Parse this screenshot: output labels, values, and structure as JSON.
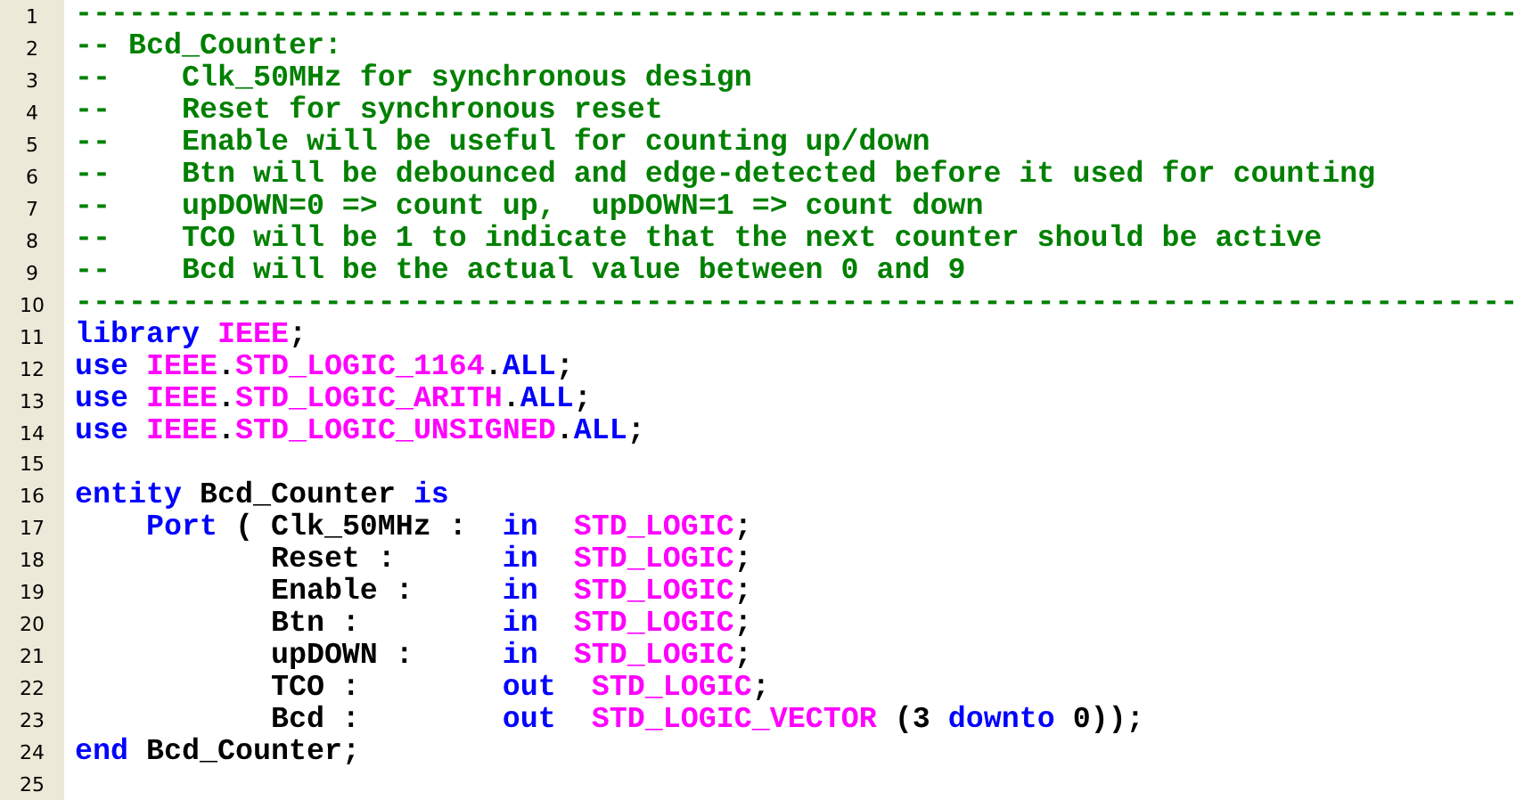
{
  "editor": {
    "lines": [
      {
        "number": "1",
        "tokens": [
          {
            "kind": "comment",
            "text": "---------------------------------------------------------------------------------"
          }
        ]
      },
      {
        "number": "2",
        "tokens": [
          {
            "kind": "comment",
            "text": "-- Bcd_Counter:"
          }
        ]
      },
      {
        "number": "3",
        "tokens": [
          {
            "kind": "comment",
            "text": "--    Clk_50MHz for synchronous design"
          }
        ]
      },
      {
        "number": "4",
        "tokens": [
          {
            "kind": "comment",
            "text": "--    Reset for synchronous reset"
          }
        ]
      },
      {
        "number": "5",
        "tokens": [
          {
            "kind": "comment",
            "text": "--    Enable will be useful for counting up/down"
          }
        ]
      },
      {
        "number": "6",
        "tokens": [
          {
            "kind": "comment",
            "text": "--    Btn will be debounced and edge-detected before it used for counting"
          }
        ]
      },
      {
        "number": "7",
        "tokens": [
          {
            "kind": "comment",
            "text": "--    upDOWN=0 => count up,  upDOWN=1 => count down"
          }
        ]
      },
      {
        "number": "8",
        "tokens": [
          {
            "kind": "comment",
            "text": "--    TCO will be 1 to indicate that the next counter should be active"
          }
        ]
      },
      {
        "number": "9",
        "tokens": [
          {
            "kind": "comment",
            "text": "--    Bcd will be the actual value between 0 and 9"
          }
        ]
      },
      {
        "number": "10",
        "tokens": [
          {
            "kind": "comment",
            "text": "---------------------------------------------------------------------------------"
          }
        ]
      },
      {
        "number": "11",
        "tokens": [
          {
            "kind": "keyword",
            "text": "library"
          },
          {
            "kind": "type",
            "text": " IEEE"
          },
          {
            "kind": "plain",
            "text": ";"
          }
        ]
      },
      {
        "number": "12",
        "tokens": [
          {
            "kind": "keyword",
            "text": "use"
          },
          {
            "kind": "type",
            "text": " IEEE"
          },
          {
            "kind": "plain",
            "text": "."
          },
          {
            "kind": "type",
            "text": "STD_LOGIC_1164"
          },
          {
            "kind": "plain",
            "text": "."
          },
          {
            "kind": "keyword",
            "text": "ALL"
          },
          {
            "kind": "plain",
            "text": ";"
          }
        ]
      },
      {
        "number": "13",
        "tokens": [
          {
            "kind": "keyword",
            "text": "use"
          },
          {
            "kind": "type",
            "text": " IEEE"
          },
          {
            "kind": "plain",
            "text": "."
          },
          {
            "kind": "type",
            "text": "STD_LOGIC_ARITH"
          },
          {
            "kind": "plain",
            "text": "."
          },
          {
            "kind": "keyword",
            "text": "ALL"
          },
          {
            "kind": "plain",
            "text": ";"
          }
        ]
      },
      {
        "number": "14",
        "tokens": [
          {
            "kind": "keyword",
            "text": "use"
          },
          {
            "kind": "type",
            "text": " IEEE"
          },
          {
            "kind": "plain",
            "text": "."
          },
          {
            "kind": "type",
            "text": "STD_LOGIC_UNSIGNED"
          },
          {
            "kind": "plain",
            "text": "."
          },
          {
            "kind": "keyword",
            "text": "ALL"
          },
          {
            "kind": "plain",
            "text": ";"
          }
        ]
      },
      {
        "number": "15"
      },
      {
        "number": "16",
        "tokens": [
          {
            "kind": "keyword",
            "text": "entity"
          },
          {
            "kind": "plain",
            "text": " Bcd_Counter"
          },
          {
            "kind": "keyword",
            "text": " is"
          }
        ]
      },
      {
        "number": "17",
        "tokens": [
          {
            "kind": "keyword",
            "text": "    Port"
          },
          {
            "kind": "plain",
            "text": " ( Clk_50MHz :"
          },
          {
            "kind": "keyword",
            "text": "  in"
          },
          {
            "kind": "type",
            "text": "  STD_LOGIC"
          },
          {
            "kind": "plain",
            "text": ";"
          }
        ]
      },
      {
        "number": "18",
        "tokens": [
          {
            "kind": "plain",
            "text": "           Reset :"
          },
          {
            "kind": "keyword",
            "text": "      in"
          },
          {
            "kind": "type",
            "text": "  STD_LOGIC"
          },
          {
            "kind": "plain",
            "text": ";"
          }
        ]
      },
      {
        "number": "19",
        "tokens": [
          {
            "kind": "plain",
            "text": "           Enable :"
          },
          {
            "kind": "keyword",
            "text": "     in"
          },
          {
            "kind": "type",
            "text": "  STD_LOGIC"
          },
          {
            "kind": "plain",
            "text": ";"
          }
        ]
      },
      {
        "number": "20",
        "tokens": [
          {
            "kind": "plain",
            "text": "           Btn :"
          },
          {
            "kind": "keyword",
            "text": "        in"
          },
          {
            "kind": "type",
            "text": "  STD_LOGIC"
          },
          {
            "kind": "plain",
            "text": ";"
          }
        ]
      },
      {
        "number": "21",
        "tokens": [
          {
            "kind": "plain",
            "text": "           upDOWN :"
          },
          {
            "kind": "keyword",
            "text": "     in"
          },
          {
            "kind": "type",
            "text": "  STD_LOGIC"
          },
          {
            "kind": "plain",
            "text": ";"
          }
        ]
      },
      {
        "number": "22",
        "tokens": [
          {
            "kind": "plain",
            "text": "           TCO :"
          },
          {
            "kind": "keyword",
            "text": "        out"
          },
          {
            "kind": "type",
            "text": "  STD_LOGIC"
          },
          {
            "kind": "plain",
            "text": ";"
          }
        ]
      },
      {
        "number": "23",
        "tokens": [
          {
            "kind": "plain",
            "text": "           Bcd :"
          },
          {
            "kind": "keyword",
            "text": "        out"
          },
          {
            "kind": "type",
            "text": "  STD_LOGIC_VECTOR"
          },
          {
            "kind": "plain",
            "text": " (3"
          },
          {
            "kind": "keyword",
            "text": " downto"
          },
          {
            "kind": "plain",
            "text": " 0));"
          }
        ]
      },
      {
        "number": "24",
        "tokens": [
          {
            "kind": "keyword",
            "text": "end"
          },
          {
            "kind": "plain",
            "text": " Bcd_Counter;"
          }
        ]
      },
      {
        "number": "25"
      }
    ]
  }
}
